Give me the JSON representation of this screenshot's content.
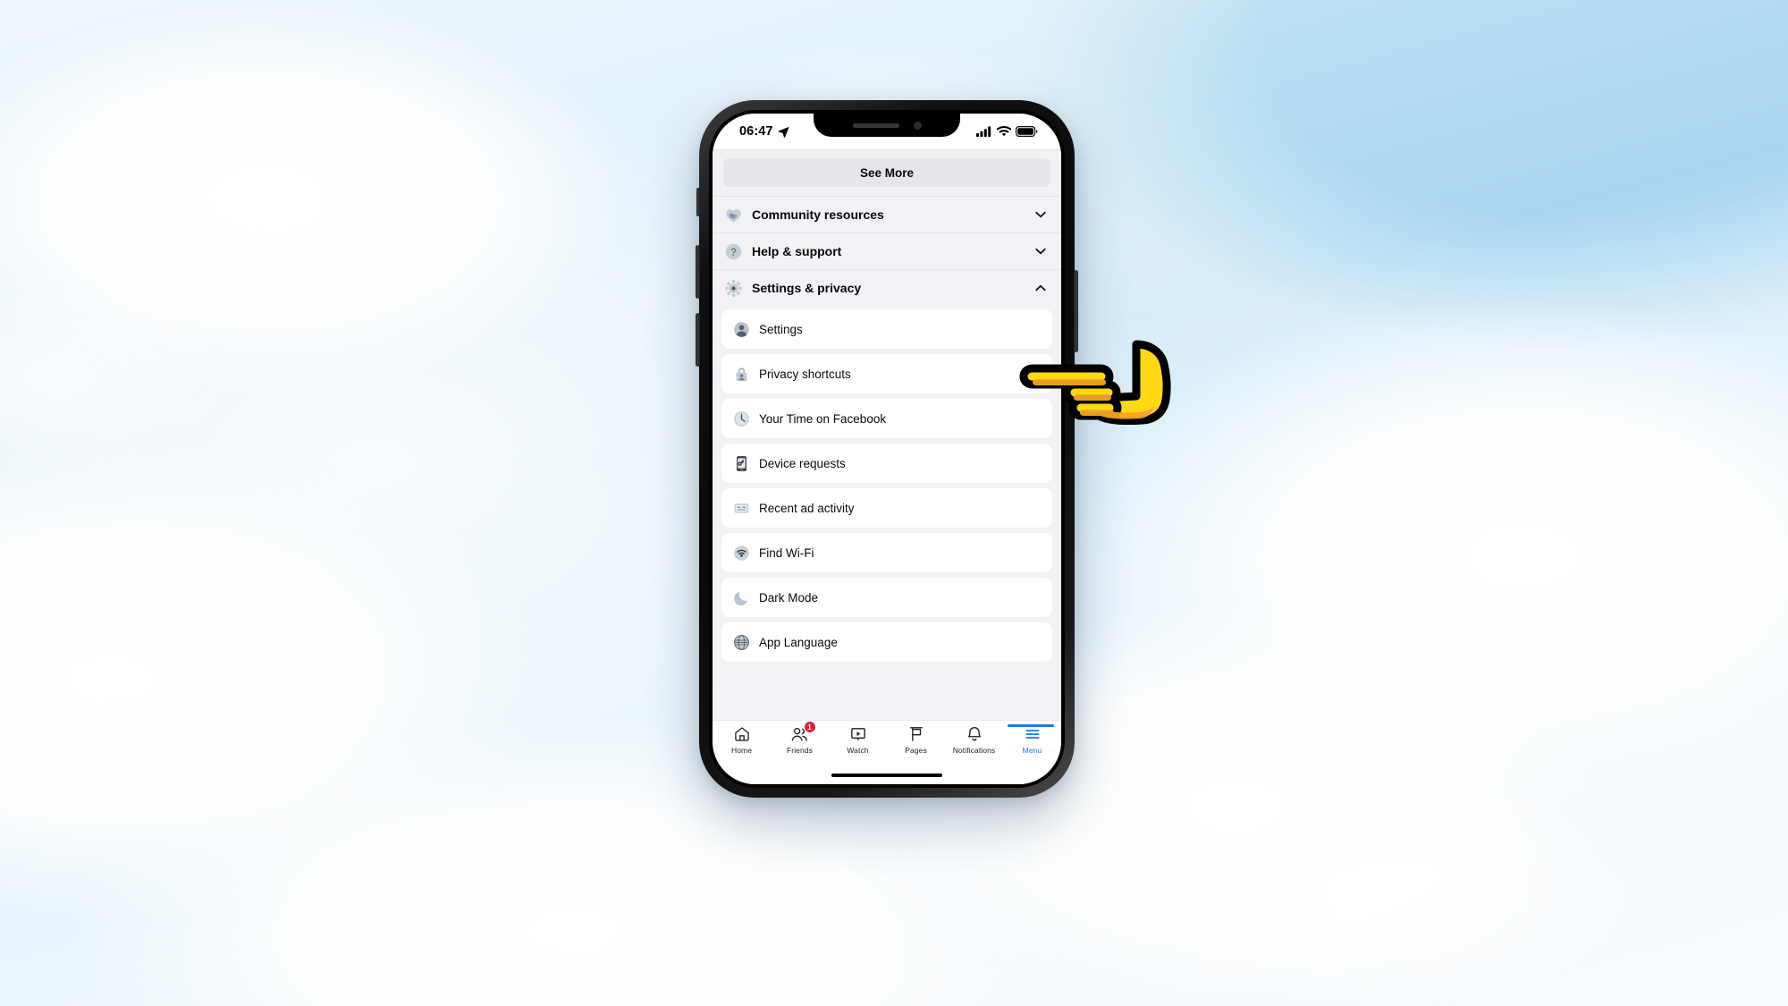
{
  "background": {
    "type": "sky-with-clouds",
    "sky_color": "#a9d6ef",
    "cloud_color": "#ffffff"
  },
  "device": {
    "type": "iphone-x",
    "frame_color": "#0a0a0b"
  },
  "status_bar": {
    "time": "06:47",
    "location_icon": "location-arrow-icon",
    "cellular_icon": "signal-bars-icon",
    "wifi_icon": "wifi-icon",
    "battery_icon": "battery-icon"
  },
  "app": {
    "name": "Facebook",
    "screen": "Menu",
    "see_more_label": "See More",
    "groups": [
      {
        "label": "Community resources",
        "icon": "handshake-heart-icon",
        "expanded": false,
        "chevron": "chevron-down-icon"
      },
      {
        "label": "Help & support",
        "icon": "question-circle-icon",
        "expanded": false,
        "chevron": "chevron-down-icon"
      },
      {
        "label": "Settings & privacy",
        "icon": "gear-icon",
        "expanded": true,
        "chevron": "chevron-up-icon"
      }
    ],
    "settings_items": [
      {
        "label": "Settings",
        "icon": "person-circle-icon"
      },
      {
        "label": "Privacy shortcuts",
        "icon": "lock-person-icon"
      },
      {
        "label": "Your Time on Facebook",
        "icon": "clock-icon"
      },
      {
        "label": "Device requests",
        "icon": "device-key-icon"
      },
      {
        "label": "Recent ad activity",
        "icon": "ad-screen-icon"
      },
      {
        "label": "Find Wi-Fi",
        "icon": "wifi-icon"
      },
      {
        "label": "Dark Mode",
        "icon": "moon-icon"
      },
      {
        "label": "App Language",
        "icon": "globe-icon"
      }
    ],
    "tabs": [
      {
        "label": "Home",
        "icon": "home-icon",
        "active": false,
        "badge": ""
      },
      {
        "label": "Friends",
        "icon": "friends-icon",
        "active": false,
        "badge": "1"
      },
      {
        "label": "Watch",
        "icon": "watch-play-icon",
        "active": false,
        "badge": ""
      },
      {
        "label": "Pages",
        "icon": "flag-icon",
        "active": false,
        "badge": ""
      },
      {
        "label": "Notifications",
        "icon": "bell-icon",
        "active": false,
        "badge": ""
      },
      {
        "label": "Menu",
        "icon": "hamburger-menu-icon",
        "active": true,
        "badge": ""
      }
    ],
    "accent_color": "#1877f2",
    "badge_color": "#e41e3f"
  },
  "cursor": {
    "icon": "pointing-hand-left-icon",
    "color": "#ffe01b",
    "target": "Settings"
  }
}
